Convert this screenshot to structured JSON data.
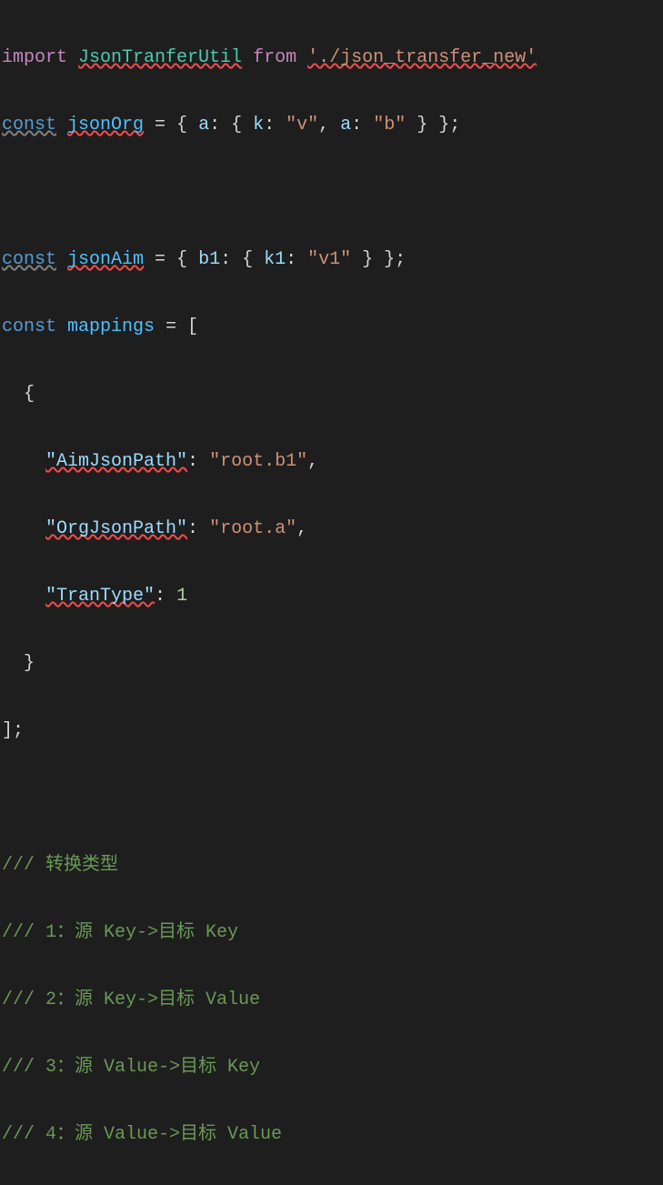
{
  "code": {
    "line1": {
      "import": "import",
      "className": "JsonTranferUtil",
      "from": "from",
      "path": "'./json_transfer_new'"
    },
    "line2": {
      "const": "const",
      "varName": "jsonOrg",
      "equals": " = { ",
      "prop_a1": "a",
      "colon1": ": { ",
      "prop_k": "k",
      "colon2": ": ",
      "val_v": "\"v\"",
      "comma1": ", ",
      "prop_a2": "a",
      "colon3": ": ",
      "val_b": "\"b\"",
      "end": " } };"
    },
    "line4": {
      "const": "const",
      "varName": "jsonAim",
      "equals": " = { ",
      "prop_b1": "b1",
      "colon1": ": { ",
      "prop_k1": "k1",
      "colon2": ": ",
      "val_v1": "\"v1\"",
      "end": " } };"
    },
    "line5": {
      "const": "const",
      "varName": "mappings",
      "equals": " = ["
    },
    "line6": "  {",
    "line7": {
      "indent": "    ",
      "key": "\"AimJsonPath\"",
      "colon": ": ",
      "val": "\"root.b1\"",
      "comma": ","
    },
    "line8": {
      "indent": "    ",
      "key": "\"OrgJsonPath\"",
      "colon": ": ",
      "val": "\"root.a\"",
      "comma": ","
    },
    "line9": {
      "indent": "    ",
      "key": "\"TranType\"",
      "colon": ": ",
      "val": "1"
    },
    "line10": "  }",
    "line11": "];",
    "comment1": "/// 转换类型",
    "comment2": "/// 1：源 Key->目标 Key",
    "comment3": "/// 2：源 Key->目标 Value",
    "comment4": "/// 3：源 Value->目标 Key",
    "comment5": "/// 4：源 Value->目标 Value"
  }
}
